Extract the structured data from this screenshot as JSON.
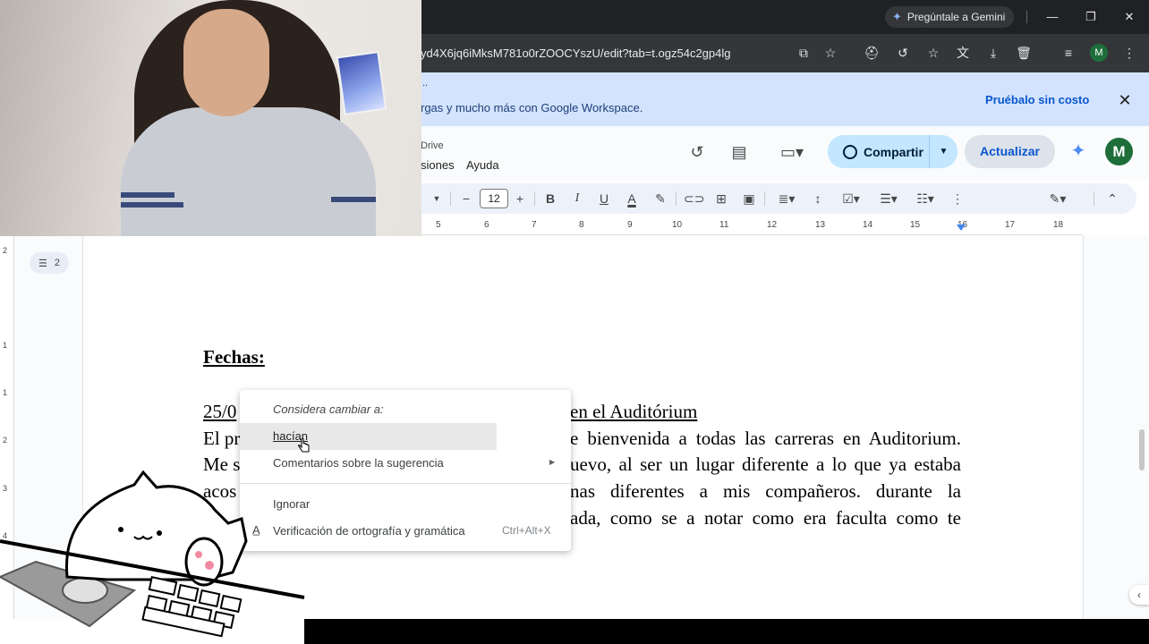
{
  "browser": {
    "gemini_label": "Pregúntale a Gemini",
    "url": "yd4X6jq6iMksM781o0rZOOCYszU/edit?tab=t.ogz54c2gp4lg",
    "profile_initial": "M"
  },
  "promo": {
    "dots": "..",
    "text": "rgas y mucho más con Google Workspace.",
    "cta": "Pruébalo sin costo"
  },
  "docs": {
    "breadcrumb": "Drive",
    "menu": [
      "siones",
      "Ayuda"
    ],
    "share_label": "Compartir",
    "update_label": "Actualizar",
    "avatar_initial": "M",
    "font_size": "12"
  },
  "ruler": {
    "numbers": [
      "5",
      "6",
      "7",
      "8",
      "9",
      "10",
      "11",
      "12",
      "13",
      "14",
      "15",
      "16",
      "17",
      "18"
    ]
  },
  "vruler": {
    "numbers": [
      "2",
      "1",
      "1",
      "2",
      "3",
      "4"
    ]
  },
  "outline": {
    "count": "2"
  },
  "document": {
    "heading": "Fechas:",
    "line1_left": "25/0",
    "line1_right": "en el Auditórium",
    "line2_left": "El pr",
    "line2_right": "e bienvenida a todas las carreras en Auditorium.",
    "line3_left": "Me s",
    "line3_right": "uevo, al ser un lugar diferente a lo que ya estaba",
    "line4_left": "acos",
    "line4_right": "nas diferentes a mis compañeros. durante la",
    "line5_right": "ada, como se a notar como era faculta como te"
  },
  "context_menu": {
    "title": "Considera cambiar a:",
    "suggestion": "hacían",
    "feedback": "Comentarios sobre la sugerencia",
    "ignore": "Ignorar",
    "spellcheck": "Verificación de ortografía y gramática",
    "shortcut": "Ctrl+Alt+X"
  },
  "icons": {
    "minimize": "—",
    "restore": "❐",
    "close": "✕"
  }
}
